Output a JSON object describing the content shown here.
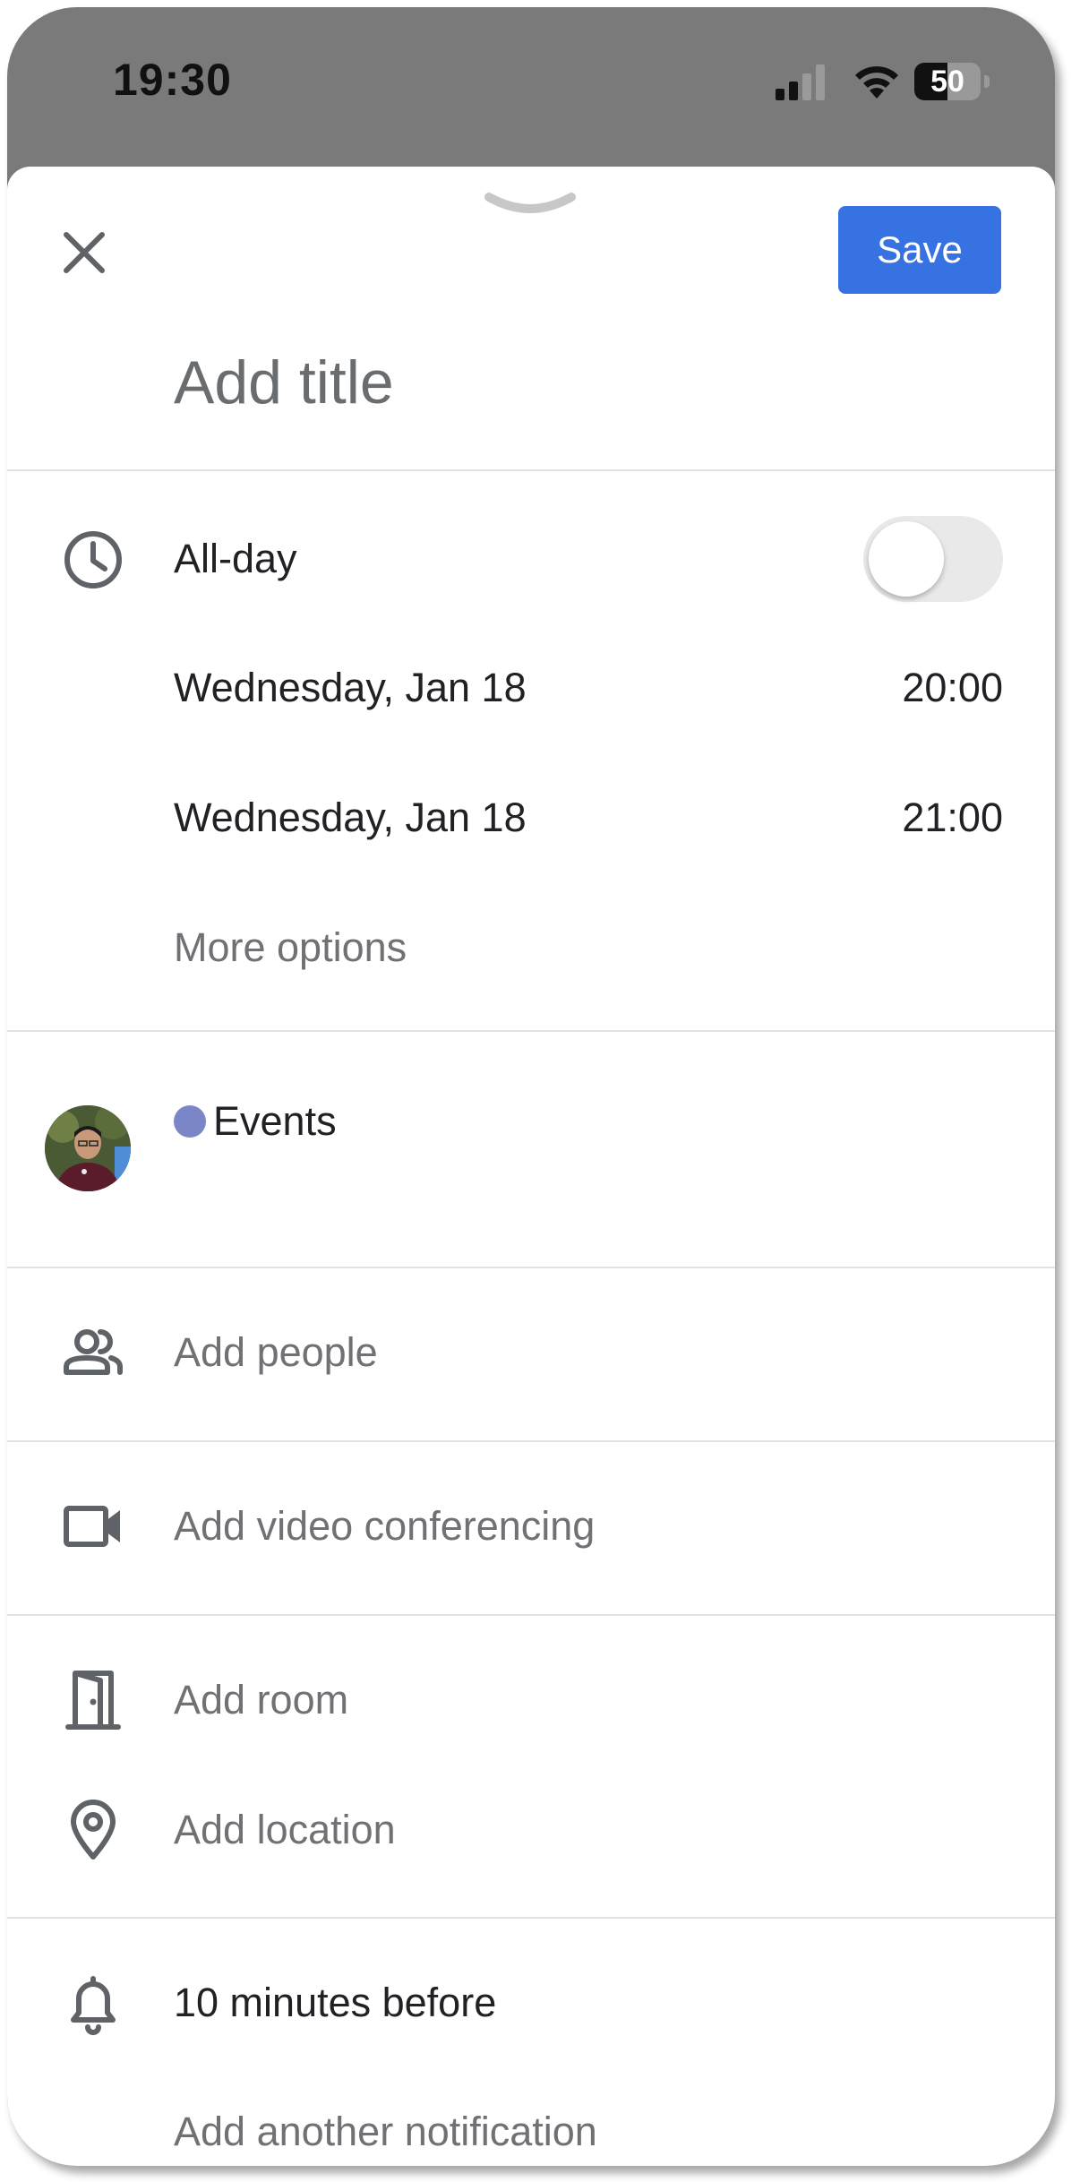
{
  "status_bar": {
    "time": "19:30",
    "battery_level": "50"
  },
  "header": {
    "save_label": "Save"
  },
  "title_field": {
    "placeholder": "Add title",
    "value": ""
  },
  "schedule": {
    "all_day_label": "All-day",
    "all_day_enabled": false,
    "start": {
      "date": "Wednesday, Jan 18",
      "time": "20:00"
    },
    "end": {
      "date": "Wednesday, Jan 18",
      "time": "21:00"
    },
    "more_options": "More options"
  },
  "calendar": {
    "name": "Events",
    "color": "#7b86c9"
  },
  "people": {
    "label": "Add people"
  },
  "video": {
    "label": "Add video conferencing"
  },
  "room": {
    "label": "Add room"
  },
  "location": {
    "label": "Add location"
  },
  "notifications": {
    "current": "10 minutes before",
    "add_label": "Add another notification"
  },
  "colors": {
    "accent": "#3772e3",
    "text": "#202124",
    "muted": "#6f7175"
  }
}
